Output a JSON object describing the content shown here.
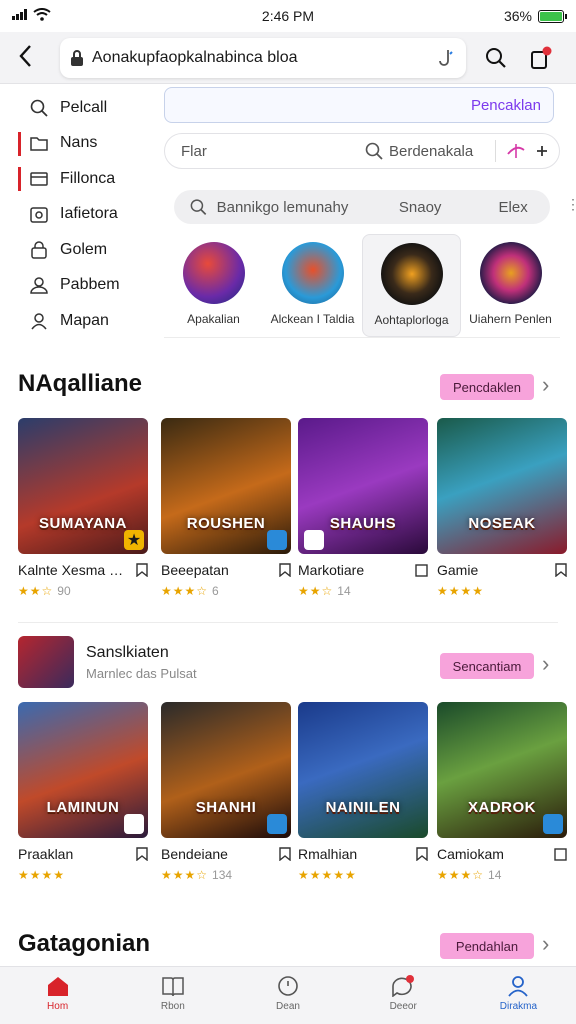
{
  "status": {
    "time": "2:46 PM",
    "battery": "36%"
  },
  "topbar": {
    "url": "Aonakupfaopkalnabinca bloa"
  },
  "sidebar": {
    "items": [
      {
        "label": "Pelcall",
        "icon": "search-icon"
      },
      {
        "label": "Nans",
        "icon": "folder-icon"
      },
      {
        "label": "Fillonca",
        "icon": "card-icon"
      },
      {
        "label": "Iafietora",
        "icon": "camera-icon"
      },
      {
        "label": "Golem",
        "icon": "lock-icon"
      },
      {
        "label": "Pabbem",
        "icon": "user-icon"
      },
      {
        "label": "Mapan",
        "icon": "person-icon"
      }
    ]
  },
  "panel": {
    "primary_button": "Pencaklan",
    "filter": {
      "left": "Flar",
      "middle": "Berdenakala"
    },
    "search": {
      "placeholder": "Bannikgo lemunahy",
      "opt1": "Snaoy",
      "opt2": "Elex"
    },
    "categories": [
      {
        "label": "Apakalian",
        "color": "#2d3a8c"
      },
      {
        "label": "Alckean I Taldia",
        "color": "#1e88c9"
      },
      {
        "label": "Aohtaplorloga",
        "color": "#3b2a1a"
      },
      {
        "label": "Uiahern Penlen",
        "color": "#1a1a44"
      }
    ]
  },
  "sections": [
    {
      "title": "NAqalliane",
      "button": "Pencdaklen",
      "cards": [
        {
          "art": "SUMAYANA",
          "name": "Kalnte Xesma Ion",
          "stars": "★★☆",
          "rating": "90",
          "bg": "linear-gradient(160deg,#2b3d6b,#b53a2a 60%,#4a1a1a)"
        },
        {
          "art": "ROUSHEN",
          "name": "Beeepatan",
          "stars": "★★★☆",
          "rating": "6",
          "bg": "linear-gradient(160deg,#3a2a12,#c56a1a 55%,#2a1a0a)"
        },
        {
          "art": "SHAUHS",
          "name": "Markotiare",
          "stars": "★★☆",
          "rating": "14",
          "bg": "linear-gradient(160deg,#5a1a8a,#9a3ac0 50%,#2a0a3a)"
        },
        {
          "art": "NOSEAK",
          "name": "Gamie",
          "stars": "★★★★",
          "rating": "",
          "bg": "linear-gradient(160deg,#1a5a4a,#3aa0c0 45%,#8a1a2a)"
        }
      ]
    },
    {
      "title": "",
      "button": "Sencantiam",
      "feature": {
        "title": "Sanslkiaten",
        "subtitle": "Marnlec das Pulsat"
      },
      "cards": [
        {
          "art": "LAMINUN",
          "name": "Praaklan",
          "stars": "★★★★",
          "rating": "",
          "bg": "linear-gradient(160deg,#3a6ab0,#c04a2a 55%,#2a1a3a)"
        },
        {
          "art": "SHANHI",
          "name": "Bendeiane",
          "stars": "★★★☆",
          "rating": "134",
          "bg": "linear-gradient(160deg,#2a2a2a,#b0601a 55%,#1a0a0a)"
        },
        {
          "art": "NAINILEN",
          "name": "Rmalhian",
          "stars": "★★★★★",
          "rating": "",
          "bg": "linear-gradient(160deg,#1a3a8a,#3a6ac0 45%,#1a4a2a)"
        },
        {
          "art": "XADROK",
          "name": "Camiokam",
          "stars": "★★★☆",
          "rating": "14",
          "bg": "linear-gradient(160deg,#1a4a2a,#6aa040 45%,#2a1a0a)"
        }
      ]
    },
    {
      "title": "Gatagonian",
      "button": "Pendahlan"
    }
  ],
  "bottom_nav": [
    {
      "label": "Hom",
      "icon": "home-icon"
    },
    {
      "label": "Rbon",
      "icon": "book-icon"
    },
    {
      "label": "Dean",
      "icon": "clock-icon"
    },
    {
      "label": "Deeor",
      "icon": "chat-icon"
    },
    {
      "label": "Dirakma",
      "icon": "profile-icon"
    }
  ]
}
